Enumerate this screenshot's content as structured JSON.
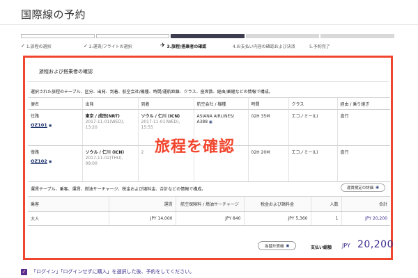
{
  "page": {
    "title": "国際線の予約"
  },
  "progress": {
    "segments": [
      "done",
      "done",
      "current",
      "todo",
      "todo"
    ],
    "steps": [
      {
        "label": "1.旅程の選択",
        "icon": "check-icon",
        "glyph": "✓"
      },
      {
        "label": "2.運賃/フライトの選択",
        "icon": "check-icon",
        "glyph": "✓"
      },
      {
        "label": "3.旅程/搭乗者の確認",
        "icon": "plane-icon",
        "glyph": "✈"
      },
      {
        "label": "4.お支払い内容の確認および決済",
        "icon": "",
        "glyph": ""
      },
      {
        "label": "5.予約完了",
        "icon": "",
        "glyph": ""
      }
    ]
  },
  "card": {
    "title": "旅程および搭乗者の確認",
    "desc_flights": "選択された旅程のテーブル、区分、出発、到着、航空会社/機種、時間/運航距離、クラス、座席数、経由/乗継などの情報で構成。",
    "flight_headers": [
      "便名",
      "出発",
      "到着",
      "航空会社 / 機種",
      "時間",
      "クラス",
      "経由 / 乗り継ぎ"
    ],
    "flights": [
      {
        "type": "往路",
        "flight_no": "OZ101",
        "dep_city": "東京 / 成田(NRT)",
        "dep_date": "2017-11-01(WED),",
        "dep_time": "13:20",
        "arr_city": "ソウル / 仁川 (ICN)",
        "arr_date": "2017-11-01(WED),",
        "arr_time": "15:55",
        "airline": "ASIANA AIRLINES/",
        "aircraft": "A388",
        "duration": "02H 35M",
        "class": "エコノミー(L)",
        "via": "直行"
      },
      {
        "type": "復路",
        "flight_no": "OZ102",
        "dep_city": "ソウル / 仁川 (ICN)",
        "dep_date": "2017-11-02(THU),",
        "dep_time": "09:00",
        "arr_city": "",
        "arr_date": "2",
        "arr_time": "",
        "airline": "",
        "aircraft": "",
        "duration": "02H 20M",
        "class": "エコノミー(L)",
        "via": "直行"
      }
    ],
    "desc_fares": "運賃テーブル、乗客、運賃、燃油サーチャージ、税金および諸料金、合計などの情報で構成。",
    "rules_button": "運賃規定の詳細",
    "fare_headers": [
      "乗客",
      "運賃",
      "航空保険料 / 燃油サーチャージ",
      "税金および諸料金",
      "人数",
      "合計"
    ],
    "fares": [
      {
        "passenger": "大人",
        "fare": "JPY 14,000",
        "surcharge": "JPY 840",
        "tax": "JPY 5,360",
        "count": "1",
        "total": "JPY 20,200"
      }
    ],
    "calc_button": "為替計算機",
    "total_label": "支払い総額",
    "total_currency": "JPY",
    "total_amount": "20,200"
  },
  "overlay": {
    "text": "旅程を確認"
  },
  "notice": {
    "text": "「ログイン」「ログインせずに購入」を選択した後、予約をしてください。"
  },
  "colors": {
    "accent": "#f1462e",
    "brand": "#3a2a8c",
    "navy": "#1a2f6b"
  }
}
